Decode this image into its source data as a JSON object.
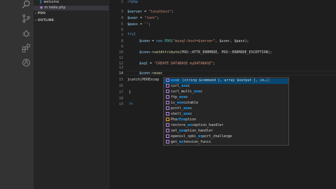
{
  "activity_bar": {
    "icons": [
      "search-icon",
      "source-control-icon",
      "debug-icon",
      "extensions-icon",
      "remote-icon"
    ]
  },
  "sidebar": {
    "files": [
      {
        "label": "welcome",
        "icon": "vscode-icon"
      },
      {
        "label": "m  table.php",
        "icon": "php-icon"
      }
    ],
    "sections": [
      "PDO",
      "OUTLINE"
    ]
  },
  "editor": {
    "line_numbers": [
      "2",
      "3",
      "4",
      "5",
      "6",
      "7",
      "8",
      "9",
      "10",
      "11",
      "12",
      "13",
      "14",
      "15",
      "16",
      "17",
      "18",
      "19"
    ],
    "active_line": "14",
    "code": {
      "l2": "<?php",
      "l3_var": "$server",
      "l3_eq": " = ",
      "l3_str": "\"localhost\"",
      "l3_end": ";",
      "l4_var": "$user",
      "l4_eq": " = ",
      "l4_str": "\"root\"",
      "l4_end": ";",
      "l5_var": "$pass",
      "l5_eq": " = ",
      "l5_str": "''",
      "l5_end": ";",
      "l7": "try{",
      "l8_var": "$conn",
      "l8_mid": " = ",
      "l8_kw": "new ",
      "l8_cls": "PDO",
      "l8_open": "(",
      "l8_str": "\"mysql:host=$server\"",
      "l8_rest": ", $user, $pass);",
      "l10_var": "$conn",
      "l10_op": "->",
      "l10_fn": "setAttribute",
      "l10_rest": "(PDO::ATTR_ERRMODE, PDO::ERRMODE_EXCEPTION);",
      "l12_var": "$sql",
      "l12_eq": " = ",
      "l12_str": "\"CREATE DATABASE myDATABASE\"",
      "l12_end": ";",
      "l14_var": "$conn",
      "l14_op": "->",
      "l14_fn": "exec",
      "l15": "}catch(PDOExcep",
      "l17": "}",
      "l19": "?>"
    }
  },
  "suggest": {
    "items": [
      {
        "match": "exe",
        "rest": "c",
        "detail": "(string $command [, array $output [, in…ⓘ",
        "selected": true,
        "pre": ""
      },
      {
        "pre": "curl_",
        "match": "exe",
        "rest": "c",
        "detail": "",
        "selected": false
      },
      {
        "pre": "curl_multi_",
        "match": "exe",
        "rest": "c",
        "detail": "",
        "selected": false
      },
      {
        "pre": "ftp_",
        "match": "exe",
        "rest": "c",
        "detail": "",
        "selected": false
      },
      {
        "pre": "is_",
        "match": "exe",
        "rest": "cutable",
        "detail": "",
        "selected": false
      },
      {
        "pre": "pcntl_",
        "match": "exe",
        "rest": "c",
        "detail": "",
        "selected": false
      },
      {
        "pre": "shell_",
        "match": "exe",
        "rest": "c",
        "detail": "",
        "selected": false
      },
      {
        "pre": "Pha",
        "match": "rExe",
        "rest": "ption",
        "detail": "",
        "selected": false
      },
      {
        "pre": "restore_",
        "match": "ex",
        "rest": "ception_handler",
        "detail": "",
        "selected": false
      },
      {
        "pre": "set_",
        "match": "exe",
        "rest": "ption_handler",
        "detail": "",
        "selected": false
      },
      {
        "pre": "openssl_spki_",
        "match": "ex",
        "rest": "port_challenge",
        "detail": "",
        "selected": false
      },
      {
        "pre": "get_",
        "match": "ex",
        "rest": "tension_funcs",
        "detail": "",
        "selected": false
      }
    ]
  },
  "colors": {
    "activity_bar": "#333333",
    "sidebar": "#252526",
    "editor": "#1e1e1e",
    "suggest_selected": "#094771",
    "suggest_match": "#18a3ff"
  }
}
